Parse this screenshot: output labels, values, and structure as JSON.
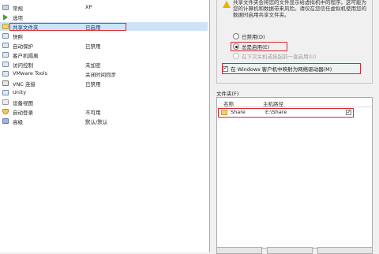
{
  "hardware_list": [
    {
      "name": "常规",
      "value": "XP",
      "icon": "settings-icon"
    },
    {
      "name": "选项",
      "value": "",
      "icon": "play-icon"
    },
    {
      "name": "共享文件夹",
      "value": "已启用",
      "icon": "folder-icon",
      "selected": true
    },
    {
      "name": "快照",
      "value": "",
      "icon": "snapshot-icon"
    },
    {
      "name": "自动保护",
      "value": "已禁用",
      "icon": "shield-icon"
    },
    {
      "name": "客户机隔离",
      "value": "",
      "icon": "isolation-icon"
    },
    {
      "name": "访问控制",
      "value": "未加密",
      "icon": "lock-icon"
    },
    {
      "name": "VMware Tools",
      "value": "关闭时间同步",
      "icon": "vmware-tools-icon"
    },
    {
      "name": "VNC 连接",
      "value": "已禁用",
      "icon": "monitor-icon"
    },
    {
      "name": "Unity",
      "value": "",
      "icon": "unity-icon"
    },
    {
      "name": "设备视图",
      "value": "",
      "icon": "device-view-icon"
    },
    {
      "name": "自动登录",
      "value": "不可用",
      "icon": "user-icon"
    },
    {
      "name": "高级",
      "value": "默认/默认",
      "icon": "notebook-icon"
    }
  ],
  "share_group": {
    "warning_text": "共享文件夹会将您的文件显示给虚拟机中的程序。这可能为您的计算机和数据带来风险。请仅在您信任虚拟机使用您的数据时启用共享文件夹。",
    "radio_disabled": "已禁用(D)",
    "radio_always": "总是启用(E)",
    "radio_until_off": "在下次关机或挂起前一直启用(U)",
    "map_drive_label": "在 Windows 客户机中映射为网络驱动器(M)"
  },
  "folders": {
    "label": "文件夹(F)",
    "col_name": "名称",
    "col_host_path": "主机路径",
    "rows": [
      {
        "name": "Share",
        "host_path": "E:\\Share",
        "enabled": true
      }
    ]
  }
}
